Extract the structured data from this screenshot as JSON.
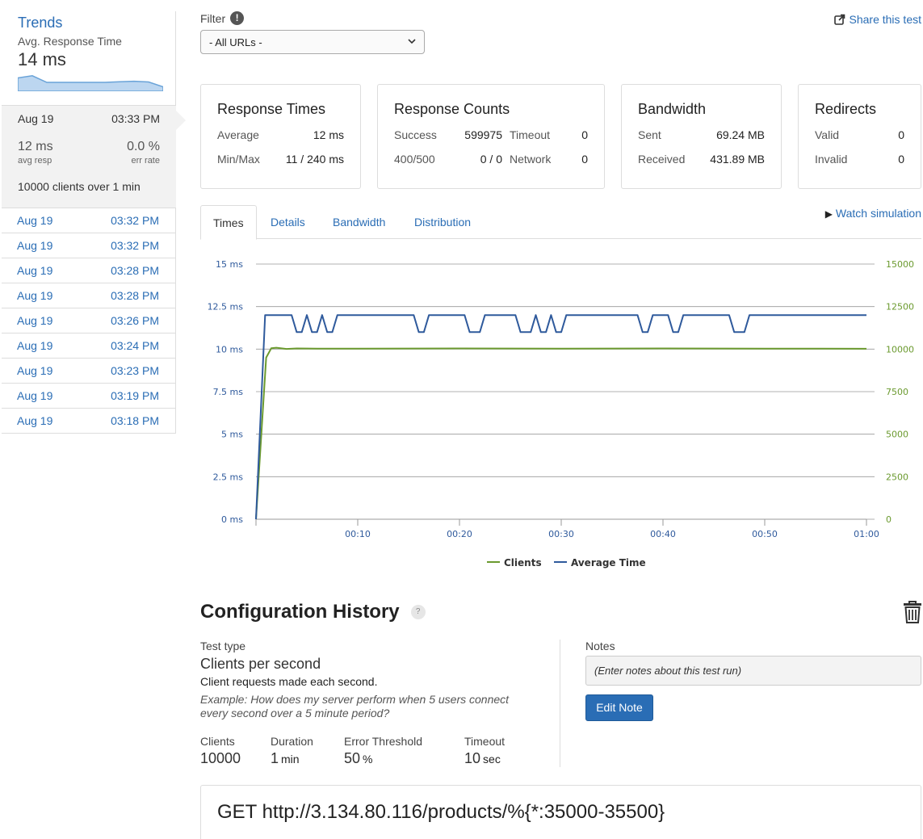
{
  "sidebar": {
    "trends_title": "Trends",
    "avg_label": "Avg. Response Time",
    "avg_value": "14 ms",
    "sparkline_values_ms": [
      14,
      15,
      12,
      12,
      12,
      12,
      12,
      12.3,
      12.5,
      12.2,
      10
    ],
    "current": {
      "date": "Aug 19",
      "time": "03:33 PM",
      "avg_resp_value": "12 ms",
      "avg_resp_label": "avg resp",
      "err_rate_value": "0.0 %",
      "err_rate_label": "err rate",
      "clients_count": "10000",
      "clients_text": "clients over",
      "duration": "1",
      "duration_unit": "min"
    },
    "history": [
      {
        "date": "Aug 19",
        "time": "03:32 PM"
      },
      {
        "date": "Aug 19",
        "time": "03:32 PM"
      },
      {
        "date": "Aug 19",
        "time": "03:28 PM"
      },
      {
        "date": "Aug 19",
        "time": "03:28 PM"
      },
      {
        "date": "Aug 19",
        "time": "03:26 PM"
      },
      {
        "date": "Aug 19",
        "time": "03:24 PM"
      },
      {
        "date": "Aug 19",
        "time": "03:23 PM"
      },
      {
        "date": "Aug 19",
        "time": "03:19 PM"
      },
      {
        "date": "Aug 19",
        "time": "03:18 PM"
      }
    ]
  },
  "filter": {
    "label": "Filter",
    "info_icon": "!",
    "selected": "- All URLs -"
  },
  "share_label": "Share this test",
  "cards": {
    "response_times": {
      "title": "Response Times",
      "average_label": "Average",
      "average_value": "12 ms",
      "minmax_label": "Min/Max",
      "minmax_value": "11 / 240 ms"
    },
    "response_counts": {
      "title": "Response Counts",
      "success_label": "Success",
      "success_value": "599975",
      "timeout_label": "Timeout",
      "timeout_value": "0",
      "err_label": "400/500",
      "err_value": "0 / 0",
      "network_label": "Network",
      "network_value": "0"
    },
    "bandwidth": {
      "title": "Bandwidth",
      "sent_label": "Sent",
      "sent_value": "69.24 MB",
      "received_label": "Received",
      "received_value": "431.89 MB"
    },
    "redirects": {
      "title": "Redirects",
      "valid_label": "Valid",
      "valid_value": "0",
      "invalid_label": "Invalid",
      "invalid_value": "0"
    }
  },
  "tabs": [
    {
      "label": "Times",
      "active": true
    },
    {
      "label": "Details",
      "active": false
    },
    {
      "label": "Bandwidth",
      "active": false
    },
    {
      "label": "Distribution",
      "active": false
    }
  ],
  "watch_label": "Watch simulation",
  "chart_data": {
    "type": "line",
    "y_left_ticks": [
      "0 ms",
      "2.5 ms",
      "5 ms",
      "7.5 ms",
      "10 ms",
      "12.5 ms",
      "15 ms"
    ],
    "y_right_ticks": [
      "0",
      "2500",
      "5000",
      "7500",
      "10000",
      "12500",
      "15000"
    ],
    "x_ticks": [
      "00:10",
      "00:20",
      "00:30",
      "00:40",
      "00:50",
      "01:00"
    ],
    "ylim_left": [
      0,
      15
    ],
    "ylim_right": [
      0,
      15000
    ],
    "xlim_seconds": [
      0,
      60
    ],
    "grid": true,
    "legend_position": "bottom",
    "series": [
      {
        "name": "Clients",
        "color": "#6b9a2f",
        "axis": "right",
        "x": [
          0,
          1,
          1.5,
          2,
          3,
          4,
          6,
          10,
          20,
          30,
          40,
          50,
          60
        ],
        "values": [
          0,
          9500,
          10050,
          10080,
          10010,
          10040,
          10030,
          10030,
          10040,
          10030,
          10040,
          10030,
          10020
        ]
      },
      {
        "name": "Average Time",
        "color": "#2f5a9c",
        "axis": "left",
        "x": [
          0,
          0.9,
          1,
          3.5,
          4,
          4.5,
          5,
          5.5,
          6,
          6.5,
          7,
          7.5,
          8,
          15.5,
          16,
          16.5,
          17,
          20.5,
          21,
          22,
          22.5,
          25.5,
          26,
          27,
          27.5,
          28,
          28.5,
          29,
          29.5,
          30,
          30.5,
          37.5,
          38,
          38.5,
          39,
          40.5,
          41,
          41.5,
          42,
          46.5,
          47,
          48,
          48.5,
          60
        ],
        "values": [
          0,
          12,
          12,
          12,
          11,
          11,
          12,
          11,
          11,
          12,
          11,
          11,
          12,
          12,
          11,
          11,
          12,
          12,
          11,
          11,
          12,
          12,
          11,
          11,
          12,
          11,
          11,
          12,
          11,
          11,
          12,
          12,
          11,
          11,
          12,
          12,
          11,
          11,
          12,
          12,
          11,
          11,
          12,
          12
        ]
      }
    ]
  },
  "config": {
    "title": "Configuration History",
    "help_icon": "?",
    "test_type_label": "Test type",
    "test_type_value": "Clients per second",
    "test_type_desc": "Client requests made each second.",
    "example": "Example: How does my server perform when 5 users connect every second over a 5 minute period?",
    "clients_label": "Clients",
    "clients_value": "10000",
    "duration_label": "Duration",
    "duration_value": "1",
    "duration_unit": "min",
    "threshold_label": "Error Threshold",
    "threshold_value": "50",
    "threshold_unit": "%",
    "timeout_label": "Timeout",
    "timeout_value": "10",
    "timeout_unit": "sec",
    "notes_label": "Notes",
    "notes_placeholder": "(Enter notes about this test run)",
    "edit_button": "Edit Note"
  },
  "request_line": "GET http://3.134.80.116/products/%{*:35000-35500}"
}
